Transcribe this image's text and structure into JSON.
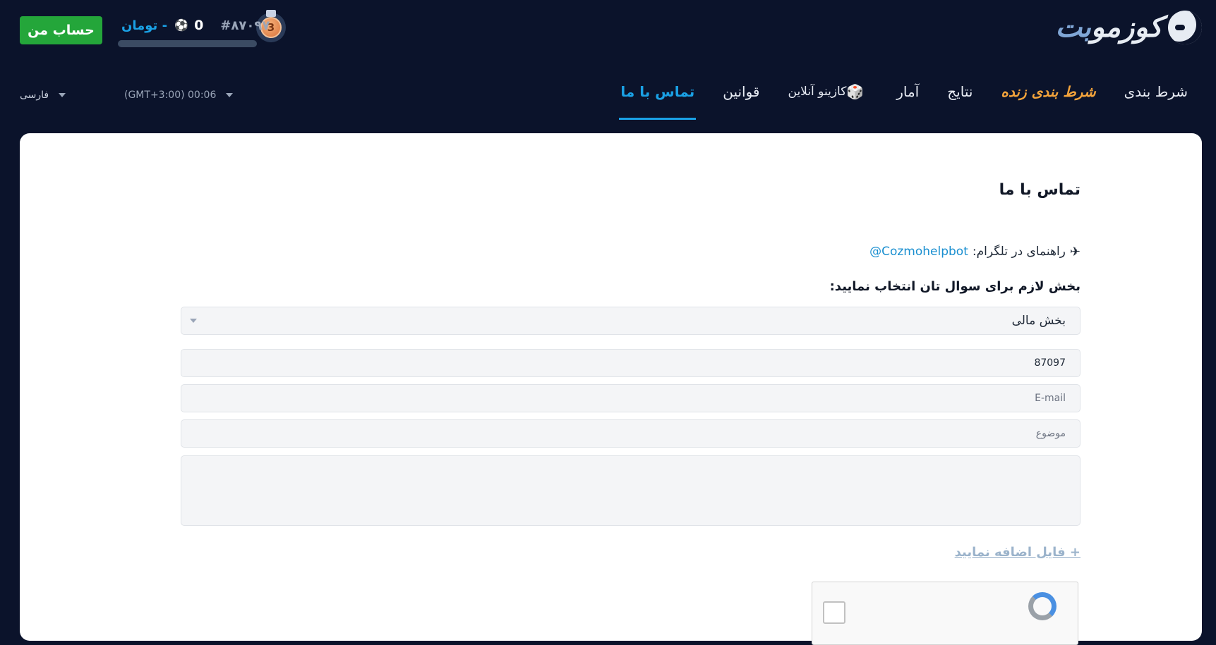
{
  "header": {
    "logo_text_main": "کوزمو",
    "logo_text_accent": "بت",
    "account_button": "حساب من",
    "balance_amount": "0",
    "balance_currency": "تومان -",
    "user_id": "#۸۷۰۹۷",
    "medal_level": "3",
    "progress_fraction": 0.0
  },
  "nav": {
    "items": [
      {
        "label": "شرط بندی"
      },
      {
        "label": "شرط بندی زنده"
      },
      {
        "label": "نتایج"
      },
      {
        "label": "آمار"
      },
      {
        "label": "کازینو آنلاین"
      },
      {
        "label": "قوانین"
      },
      {
        "label": "تماس با ما"
      }
    ],
    "time": "(GMT+3:00) 00:06",
    "language": "فارسی"
  },
  "page": {
    "title": "تماس با ما",
    "telegram_label": "راهنمای در تلگرام:",
    "telegram_link": "@Cozmohelpbot",
    "section_label": "بخش لازم برای سوال تان انتخاب نمایید:",
    "section_selected": "بخش مالی",
    "user_value": "87097",
    "email_placeholder": "E-mail",
    "subject_placeholder": "موضوع",
    "message_value": "",
    "add_file": "+ فایل اضافه نمایید"
  },
  "colors": {
    "background": "#0b132b",
    "accent_blue": "#1aa1e5",
    "live_orange": "#f3a33b",
    "account_green": "#24a63a"
  }
}
